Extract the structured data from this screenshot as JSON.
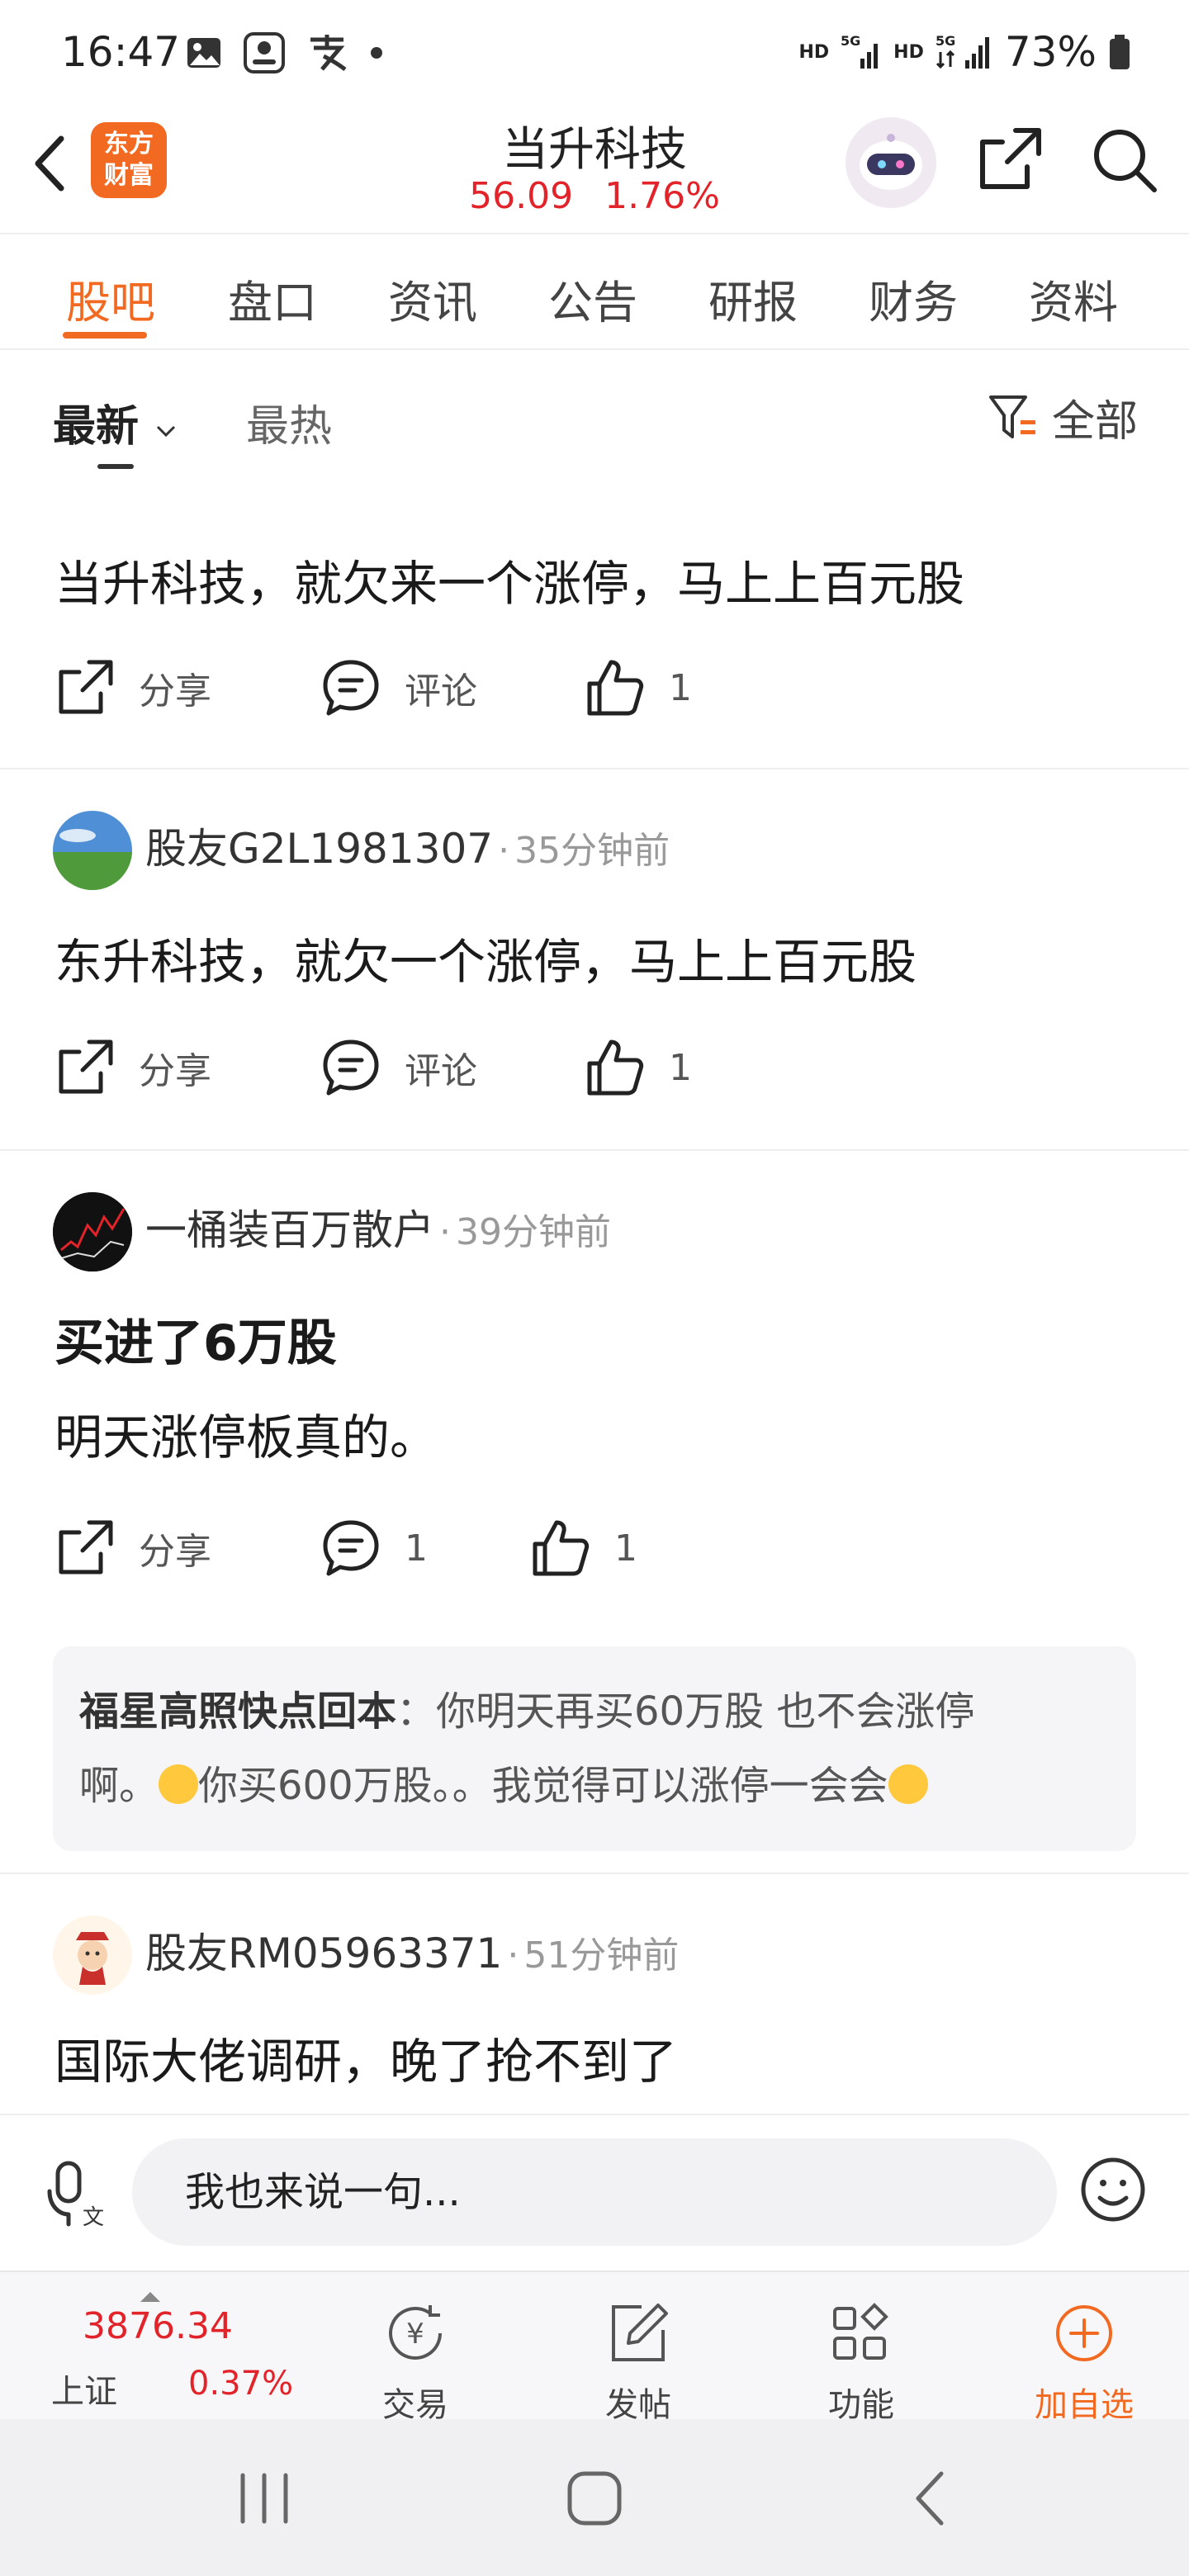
{
  "status_bar": {
    "time": "16:47",
    "battery": "73%",
    "net1": "HD",
    "net2": "5G",
    "net3": "HD",
    "net4": "5G"
  },
  "header": {
    "logo_line1": "东方",
    "logo_line2": "财富",
    "stock_name": "当升科技",
    "price": "56.09",
    "change_pct": "1.76%"
  },
  "tabs": [
    "股吧",
    "盘口",
    "资讯",
    "公告",
    "研报",
    "财务",
    "资料"
  ],
  "filters": {
    "latest": "最新",
    "hot": "最热",
    "all": "全部"
  },
  "posts": [
    {
      "text": "当升科技，就欠来一个涨停，马上上百元股",
      "actions": {
        "share": "分享",
        "comment": "评论",
        "like_count": "1"
      }
    },
    {
      "author": "股友G2L1981307",
      "time": "35分钟前",
      "text": "东升科技，就欠一个涨停，马上上百元股",
      "actions": {
        "share": "分享",
        "comment": "评论",
        "like_count": "1"
      }
    },
    {
      "author": "一桶装百万散户",
      "time": "39分钟前",
      "title": "买进了6万股",
      "text": "明天涨停板真的。",
      "actions": {
        "share": "分享",
        "comment_count": "1",
        "like_count": "1"
      },
      "reply": {
        "user": "福星高照快点回本",
        "line1": "：你明天再买60万股 也不会涨停",
        "line2a": "啊。",
        "line2b": "你买600万股。。我觉得可以涨停一会会"
      }
    },
    {
      "author": "股友RM05963371",
      "time": "51分钟前",
      "text": "国际大佬调研，晚了抢不到了"
    }
  ],
  "comment_bar": {
    "placeholder": "我也来说一句..."
  },
  "bottom_bar": {
    "index_value": "3876.34",
    "index_name": "上证",
    "index_pct": "0.37%",
    "trade": "交易",
    "post": "发帖",
    "functions": "功能",
    "add_watchlist": "加自选"
  },
  "colors": {
    "accent": "#f26a21",
    "up": "#e2232a"
  }
}
